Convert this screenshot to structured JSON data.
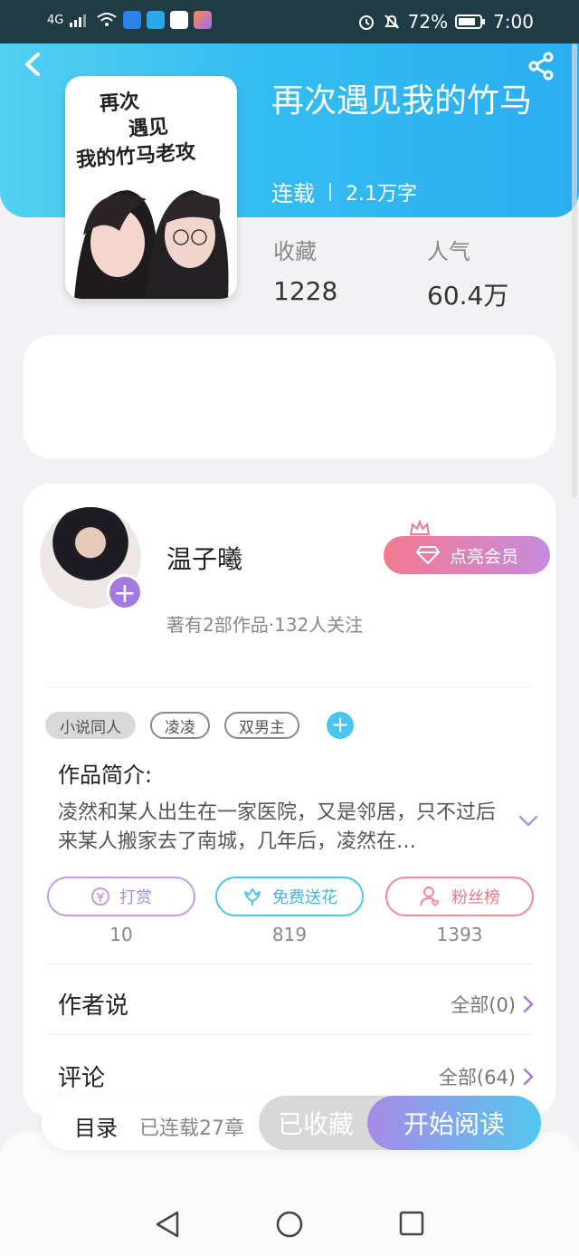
{
  "status_bar": {
    "network": "4G",
    "battery": "72%",
    "time": "7:00"
  },
  "book": {
    "title": "再次遇见我的竹马",
    "status": "连载",
    "word_count": "2.1万字",
    "cover_text": "再次遇见我的竹马老攻"
  },
  "stats": {
    "favorites_label": "收藏",
    "favorites_value": "1228",
    "popularity_label": "人气",
    "popularity_value": "60.4万"
  },
  "author": {
    "name": "温子曦",
    "meta": "著有2部作品·132人关注",
    "vip_label": "点亮会员"
  },
  "tags": [
    "小说同人",
    "凌凌",
    "双男主"
  ],
  "intro": {
    "title": "作品简介:",
    "text": "凌然和某人出生在一家医院，又是邻居，只不过后来某人搬家去了南城，几年后，凌然在…"
  },
  "actions": [
    {
      "label": "打赏",
      "count": "10",
      "color": "#c39be6"
    },
    {
      "label": "免费送花",
      "count": "819",
      "color": "#49c6ee"
    },
    {
      "label": "粉丝榜",
      "count": "1393",
      "color": "#ef8b98"
    }
  ],
  "sections": {
    "author_says": {
      "label": "作者说",
      "more": "全部(0)"
    },
    "comments": {
      "label": "评论",
      "more": "全部(64)"
    }
  },
  "bottom": {
    "toc": "目录",
    "chapters": "已连载27章",
    "favorited": "已收藏",
    "start_reading": "开始阅读"
  },
  "colors": {
    "accent_blue": "#34bdf1",
    "accent_purple": "#a57ae0"
  }
}
